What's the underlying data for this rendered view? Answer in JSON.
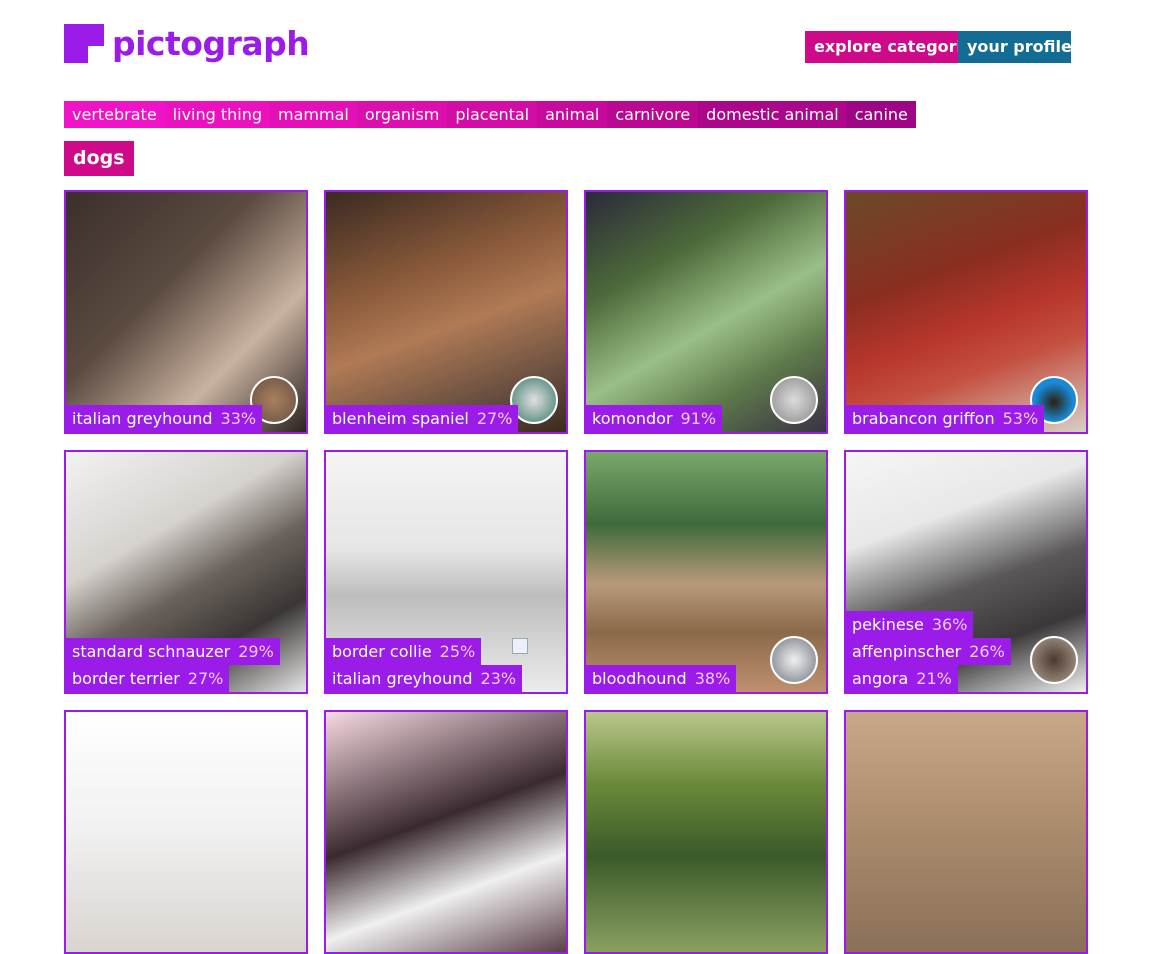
{
  "app": {
    "logo_text": "pictograph"
  },
  "nav": {
    "explore": "explore categories",
    "profile": "your profile"
  },
  "tags": [
    "vertebrate",
    "living thing",
    "mammal",
    "organism",
    "placental",
    "animal",
    "carnivore",
    "domestic animal",
    "canine"
  ],
  "category_title": "dogs",
  "colors": {
    "brand": "#9b1be8",
    "pink": "#cf0a8a",
    "profile_blue": "#126c94",
    "card_border": "#9b1be8"
  },
  "cards": [
    {
      "labels": [
        {
          "name": "italian greyhound",
          "pct": "33%"
        }
      ],
      "has_avatar": true
    },
    {
      "labels": [
        {
          "name": "blenheim spaniel",
          "pct": "27%"
        }
      ],
      "has_avatar": true
    },
    {
      "labels": [
        {
          "name": "komondor",
          "pct": "91%"
        }
      ],
      "has_avatar": true
    },
    {
      "labels": [
        {
          "name": "brabancon griffon",
          "pct": "53%"
        }
      ],
      "has_avatar": true
    },
    {
      "labels": [
        {
          "name": "standard schnauzer",
          "pct": "29%"
        },
        {
          "name": "border terrier",
          "pct": "27%"
        }
      ],
      "has_avatar": false
    },
    {
      "labels": [
        {
          "name": "border collie",
          "pct": "25%"
        },
        {
          "name": "italian greyhound",
          "pct": "23%"
        }
      ],
      "has_avatar": false
    },
    {
      "labels": [
        {
          "name": "bloodhound",
          "pct": "38%"
        }
      ],
      "has_avatar": true
    },
    {
      "labels": [
        {
          "name": "pekinese",
          "pct": "36%"
        },
        {
          "name": "affenpinscher",
          "pct": "26%"
        },
        {
          "name": "angora",
          "pct": "21%"
        }
      ],
      "has_avatar": true
    },
    {
      "labels": [],
      "has_avatar": false
    },
    {
      "labels": [],
      "has_avatar": false
    },
    {
      "labels": [],
      "has_avatar": false
    },
    {
      "labels": [],
      "has_avatar": false
    }
  ]
}
